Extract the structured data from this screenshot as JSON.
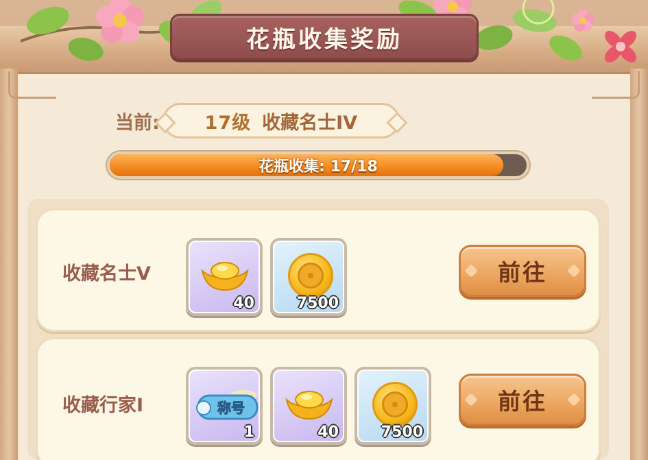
{
  "header": {
    "title": "花瓶收集奖励",
    "close_icon": "close-flower-icon"
  },
  "current": {
    "label": "当前:",
    "level": "17级",
    "rank_title": "收藏名士IV"
  },
  "progress": {
    "text": "花瓶收集: 17/18",
    "current": 17,
    "total": 18
  },
  "rewards": [
    {
      "name": "收藏名士V",
      "items": [
        {
          "icon": "gold-ingot-icon",
          "count": "40",
          "bg": "purple"
        },
        {
          "icon": "gold-coin-icon",
          "count": "7500",
          "bg": "blue"
        }
      ],
      "button_label": "前往"
    },
    {
      "name": "收藏行家I",
      "items": [
        {
          "icon": "title-badge-icon",
          "label": "称号",
          "count": "1",
          "bg": "purple"
        },
        {
          "icon": "gold-ingot-icon",
          "count": "40",
          "bg": "purple"
        },
        {
          "icon": "gold-coin-icon",
          "count": "7500",
          "bg": "blue"
        }
      ],
      "button_label": "前往"
    }
  ],
  "colors": {
    "title_plate": "#8e4d4b",
    "progress_fill": "#f48a1f",
    "button": "#eda864",
    "card_name": "#9a5c4c"
  }
}
